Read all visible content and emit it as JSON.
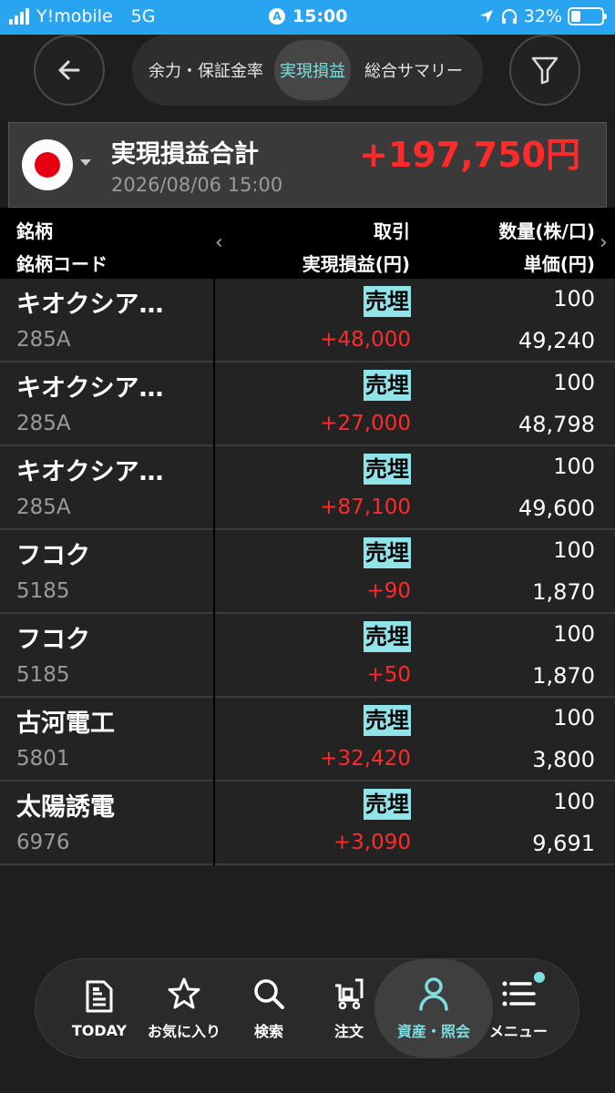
{
  "status_bar": {
    "carrier": "Y!mobile",
    "network": "5G",
    "time": "15:00",
    "battery": "32%",
    "battery_level": 0.32
  },
  "header": {
    "back_icon": "arrow-left-icon",
    "filter_icon": "funnel-icon",
    "tabs": [
      {
        "label": "余力・保証金率",
        "active": false
      },
      {
        "label": "実現損益",
        "active": true
      },
      {
        "label": "総合サマリー",
        "active": false
      }
    ]
  },
  "summary": {
    "title": "実現損益合計",
    "date": "2026/08/06 15:00",
    "total": "+197,750円",
    "flag_icon": "japan-flag-icon"
  },
  "columns": {
    "c1_top": "銘柄",
    "c1_bottom": "銘柄コード",
    "c2_top": "取引",
    "c2_bottom": "実現損益(円)",
    "c3_top": "数量(株/口)",
    "c3_bottom": "単価(円)",
    "prev": "‹",
    "next": "›"
  },
  "rows": [
    {
      "name": "キオクシア…",
      "code": "285A",
      "trade": "売埋",
      "pl": "+48,000",
      "qty": "100",
      "price": "49,240"
    },
    {
      "name": "キオクシア…",
      "code": "285A",
      "trade": "売埋",
      "pl": "+27,000",
      "qty": "100",
      "price": "48,798"
    },
    {
      "name": "キオクシア…",
      "code": "285A",
      "trade": "売埋",
      "pl": "+87,100",
      "qty": "100",
      "price": "49,600"
    },
    {
      "name": "フコク",
      "code": "5185",
      "trade": "売埋",
      "pl": "+90",
      "qty": "100",
      "price": "1,870"
    },
    {
      "name": "フコク",
      "code": "5185",
      "trade": "売埋",
      "pl": "+50",
      "qty": "100",
      "price": "1,870"
    },
    {
      "name": "古河電工",
      "code": "5801",
      "trade": "売埋",
      "pl": "+32,420",
      "qty": "100",
      "price": "3,800"
    },
    {
      "name": "太陽誘電",
      "code": "6976",
      "trade": "売埋",
      "pl": "+3,090",
      "qty": "100",
      "price": "9,691"
    }
  ],
  "nav": [
    {
      "label": "TODAY",
      "icon": "document-icon"
    },
    {
      "label": "お気に入り",
      "icon": "star-icon"
    },
    {
      "label": "検索",
      "icon": "search-icon"
    },
    {
      "label": "注文",
      "icon": "cart-icon"
    },
    {
      "label": "資産・照会",
      "icon": "person-icon",
      "active": true
    },
    {
      "label": "メニュー",
      "icon": "menu-list-icon"
    }
  ],
  "colors": {
    "status_bar": "#29a4f0",
    "accent": "#7fdde0",
    "profit": "#ff2a2a",
    "trade_badge": "#8fe4ea"
  }
}
